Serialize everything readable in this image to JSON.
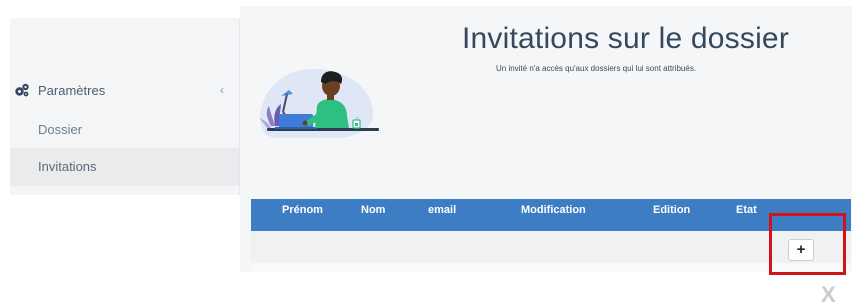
{
  "sidebar": {
    "section_label": "Paramètres",
    "section_icon": "gear-icon",
    "collapse_icon": "chevron-left-icon",
    "items": [
      {
        "label": "Dossier",
        "active": false
      },
      {
        "label": "Invitations",
        "active": true
      }
    ]
  },
  "main": {
    "title": "Invitations sur le dossier",
    "subtitle": "Un invité n'a accès qu'aux dossiers qui lui sont attribués."
  },
  "table": {
    "columns": [
      "Prénom",
      "Nom",
      "email",
      "Modification",
      "Edition",
      "Etat"
    ],
    "add_label": "+"
  },
  "close_label": "X",
  "colors": {
    "header_blue": "#3c7dc3",
    "highlight_red": "#d3131a",
    "title_text": "#34495e"
  }
}
